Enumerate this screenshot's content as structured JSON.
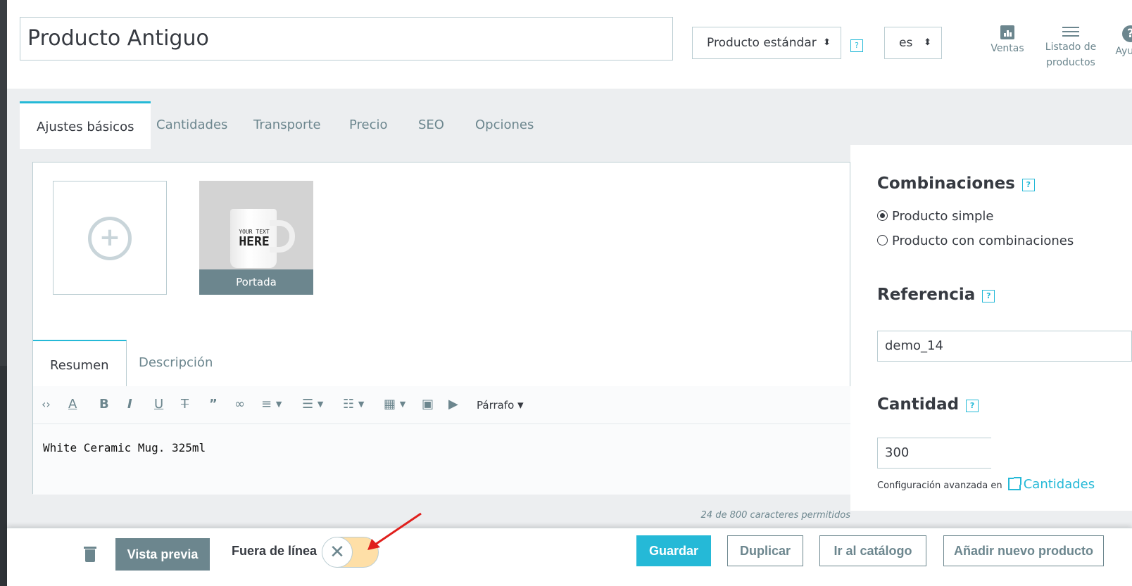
{
  "header": {
    "product_name": "Producto Antiguo",
    "product_type": "Producto estándar",
    "language": "es",
    "help_badge": "?",
    "links": {
      "ventas": "Ventas",
      "listado_line1": "Listado de",
      "listado_line2": "productos",
      "ayuda": "Ayuda"
    }
  },
  "tabs": [
    "Ajustes básicos",
    "Cantidades",
    "Transporte",
    "Precio",
    "SEO",
    "Opciones"
  ],
  "images": {
    "cover_label": "Portada",
    "mug_text_small": "YOUR TEXT",
    "mug_text_big": "HERE"
  },
  "editor": {
    "tabs": [
      "Resumen",
      "Descripción"
    ],
    "paragraph_label": "Párrafo",
    "content": "White Ceramic Mug. 325ml",
    "char_count": "24 de 800 caracteres permitidos"
  },
  "right": {
    "combinations_title": "Combinaciones",
    "option_simple": "Producto simple",
    "option_combinations": "Producto con combinaciones",
    "reference_title": "Referencia",
    "reference_value": "demo_14",
    "quantity_title": "Cantidad",
    "quantity_value": "300",
    "advanced_config": "Configuración avanzada en",
    "advanced_link": "Cantidades"
  },
  "footer": {
    "preview": "Vista previa",
    "offline": "Fuera de línea",
    "save": "Guardar",
    "duplicate": "Duplicar",
    "catalog": "Ir al catálogo",
    "add_new": "Añadir nuevo producto"
  },
  "colors": {
    "accent": "#25b9d7",
    "muted": "#6c868e",
    "toggle_off_bg": "#fedfa7",
    "arrow": "#e0201d"
  }
}
